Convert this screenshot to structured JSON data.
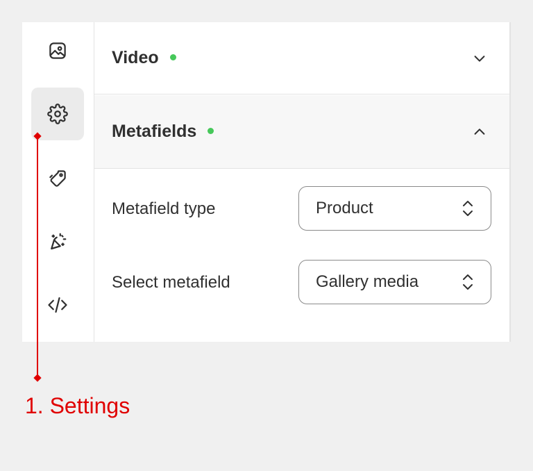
{
  "sidebar": {
    "items": [
      {
        "icon": "image-icon",
        "active": false
      },
      {
        "icon": "gear-icon",
        "active": true
      },
      {
        "icon": "tag-icon",
        "active": false
      },
      {
        "icon": "sparkle-magic-icon",
        "active": false
      },
      {
        "icon": "code-icon",
        "active": false
      }
    ]
  },
  "sections": {
    "video": {
      "title": "Video",
      "status_color": "#46c85a",
      "expanded": false
    },
    "metafields": {
      "title": "Metafields",
      "status_color": "#46c85a",
      "expanded": true
    }
  },
  "fields": {
    "metafield_type": {
      "label": "Metafield type",
      "value": "Product"
    },
    "select_metafield": {
      "label": "Select metafield",
      "value": "Gallery media"
    }
  },
  "annotation": {
    "label": "1. Settings",
    "color": "#e00000"
  }
}
